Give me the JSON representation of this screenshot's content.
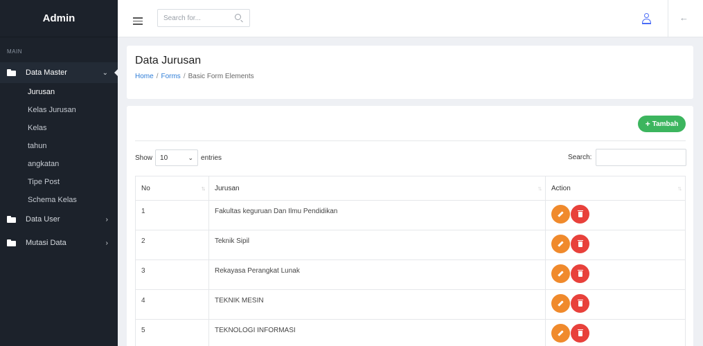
{
  "sidebar": {
    "brand": "Admin",
    "section_label": "MAIN",
    "items": [
      {
        "label": "Data Master",
        "expanded": true,
        "sub": [
          "Jurusan",
          "Kelas Jurusan",
          "Kelas",
          "tahun",
          "angkatan",
          "Tipe Post",
          "Schema Kelas"
        ]
      },
      {
        "label": "Data User"
      },
      {
        "label": "Mutasi Data"
      }
    ]
  },
  "topbar": {
    "search_placeholder": "Search for...",
    "icons": [
      "menu-icon",
      "search-icon",
      "user-icon",
      "back-arrow-icon"
    ]
  },
  "header": {
    "title": "Data Jurusan",
    "breadcrumb": [
      "Home",
      "Forms",
      "Basic Form Elements"
    ]
  },
  "toolbar": {
    "add_label": "Tambah",
    "add_color": "#3cb55e"
  },
  "table_controls": {
    "show_label": "Show",
    "entries_value": "10",
    "entries_label": "entries",
    "search_label": "Search:"
  },
  "table": {
    "columns": [
      "No",
      "Jurusan",
      "Action"
    ],
    "rows": [
      {
        "no": "1",
        "jurusan": "Fakultas keguruan Dan Ilmu Pendidikan"
      },
      {
        "no": "2",
        "jurusan": "Teknik Sipil"
      },
      {
        "no": "3",
        "jurusan": "Rekayasa Perangkat Lunak"
      },
      {
        "no": "4",
        "jurusan": "TEKNIK MESIN"
      },
      {
        "no": "5",
        "jurusan": "TEKNOLOGI INFORMASI"
      }
    ],
    "edit_color": "#f08a2c",
    "delete_color": "#e8413b"
  }
}
